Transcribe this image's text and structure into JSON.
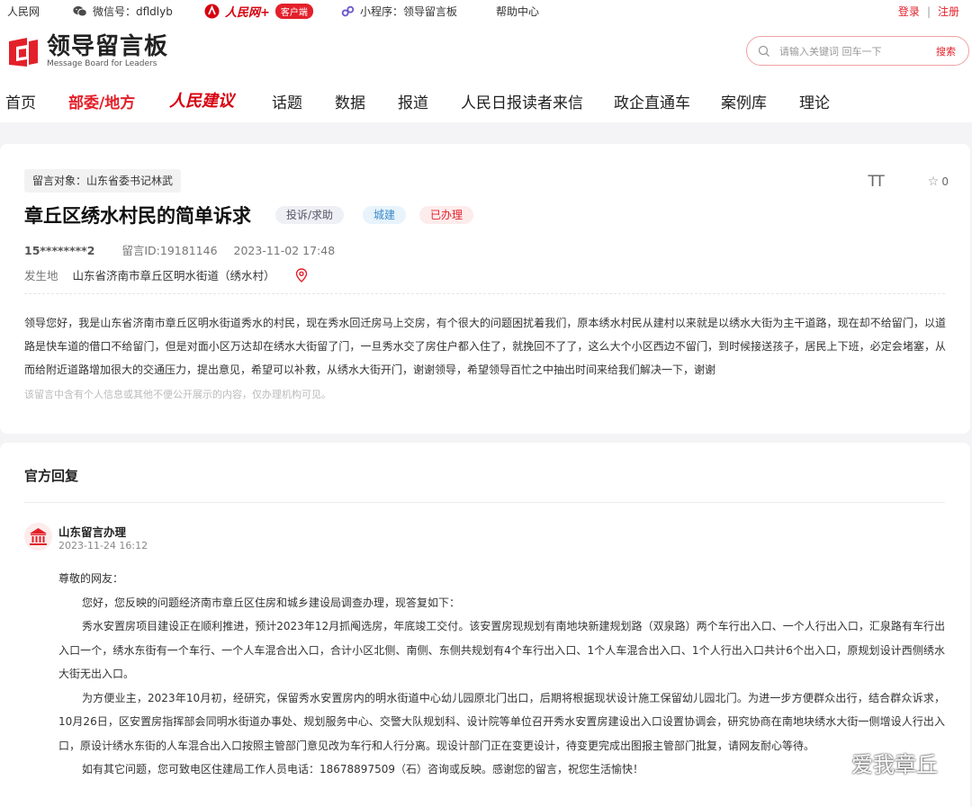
{
  "topbar": {
    "site": "人民网",
    "wechat": "微信号：dfldlyb",
    "rmw_logo": "人民网+",
    "client_label": "客户端",
    "miniprogram": "小程序：领导留言板",
    "help": "帮助中心",
    "login": "登录",
    "separator": "|",
    "register": "注册"
  },
  "brand": {
    "name_cn": "领导留言板",
    "name_en": "Message Board for Leaders"
  },
  "search": {
    "placeholder": "请输入关键词 回车一下",
    "button": "搜索"
  },
  "nav": {
    "items": [
      "首页",
      "部委/地方",
      "人民建议",
      "话题",
      "数据",
      "报道",
      "人民日报读者来信",
      "政企直通车",
      "案例库",
      "理论"
    ],
    "active_index": 1
  },
  "message": {
    "target_label": "留言对象：山东省委书记林武",
    "font_toggle": "TT",
    "favorite_count": "0",
    "title": "章丘区绣水村民的简单诉求",
    "tags": [
      "投诉/求助",
      "城建",
      "已办理"
    ],
    "user": "15********2",
    "message_id": "留言ID:19181146",
    "datetime": "2023-11-02 17:48",
    "location_label": "发生地",
    "location": "山东省济南市章丘区明水街道（绣水村）",
    "content": "领导您好，我是山东省济南市章丘区明水街道秀水的村民，现在秀水回迁房马上交房，有个很大的问题困扰着我们，原本绣水村民从建村以来就是以绣水大街为主干道路，现在却不给留门，以道路是快车道的借口不给留门，但是对面小区万达却在绣水大街留了门，一旦秀水交了房住户都入住了，就挽回不了了，这么大个小区西边不留门，到时候接送孩子，居民上下班，必定会堵塞，从而给附近道路增加很大的交通压力，提出意见，希望可以补救，从绣水大街开门，谢谢领导，希望领导百忙之中抽出时间来给我们解决一下，谢谢",
    "privacy_note": "该留言中含有个人信息或其他不便公开展示的内容，仅办理机构可见。"
  },
  "reply": {
    "heading": "官方回复",
    "org": "山东留言办理",
    "datetime": "2023-11-24 16:12",
    "salutation": "尊敬的网友：",
    "paragraphs": [
      "您好，您反映的问题经济南市章丘区住房和城乡建设局调查办理，现答复如下：",
      "秀水安置房项目建设正在顺利推进，预计2023年12月抓阄选房，年底竣工交付。该安置房现规划有南地块新建规划路（双泉路）两个车行出入口、一个人行出入口，汇泉路有车行出入口一个，绣水东街有一个车行、一个人车混合出入口，合计小区北侧、南侧、东侧共规划有4个车行出入口、1个人车混合出入口、1个人行出入口共计6个出入口，原规划设计西侧绣水大街无出入口。",
      "为方便业主，2023年10月初，经研究，保留秀水安置房内的明水街道中心幼儿园原北门出口，后期将根据现状设计施工保留幼儿园北门。为进一步方便群众出行，结合群众诉求，10月26日，区安置房指挥部会同明水街道办事处、规划服务中心、交警大队规划科、设计院等单位召开秀水安置房建设出入口设置协调会，研究协商在南地块绣水大街一侧增设人行出入口，原设计绣水东街的人车混合出入口按照主管部门意见改为车行和人行分离。现设计部门正在变更设计，待变更完成出图报主管部门批复，请网友耐心等待。",
      "如有其它问题，您可致电区住建局工作人员电话：18678897509（石）咨询或反映。感谢您的留言，祝您生活愉快！"
    ]
  },
  "watermark": "爱我章丘",
  "colors": {
    "accent": "#e3202a",
    "city_tag": "#3a8ac9",
    "background": "#f4f4f6"
  }
}
